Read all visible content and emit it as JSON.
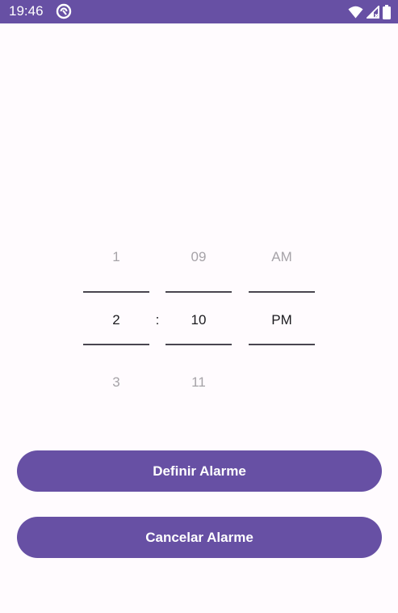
{
  "status_bar": {
    "time": "19:46",
    "icons": [
      "app-notification-icon",
      "wifi-icon",
      "cellular-signal-icon",
      "battery-icon"
    ],
    "background_color": "#6750A4"
  },
  "time_picker": {
    "hour": {
      "previous": "1",
      "selected": "2",
      "next": "3"
    },
    "separator": ":",
    "minute": {
      "previous": "09",
      "selected": "10",
      "next": "11"
    },
    "period": {
      "previous": "AM",
      "selected": "PM"
    }
  },
  "buttons": {
    "set_alarm": "Definir Alarme",
    "cancel_alarm": "Cancelar Alarme"
  },
  "colors": {
    "accent": "#6750A4",
    "background": "#FFFBFE",
    "faded_text": "#A6A3A8",
    "selected_text": "#1C1B1F"
  }
}
